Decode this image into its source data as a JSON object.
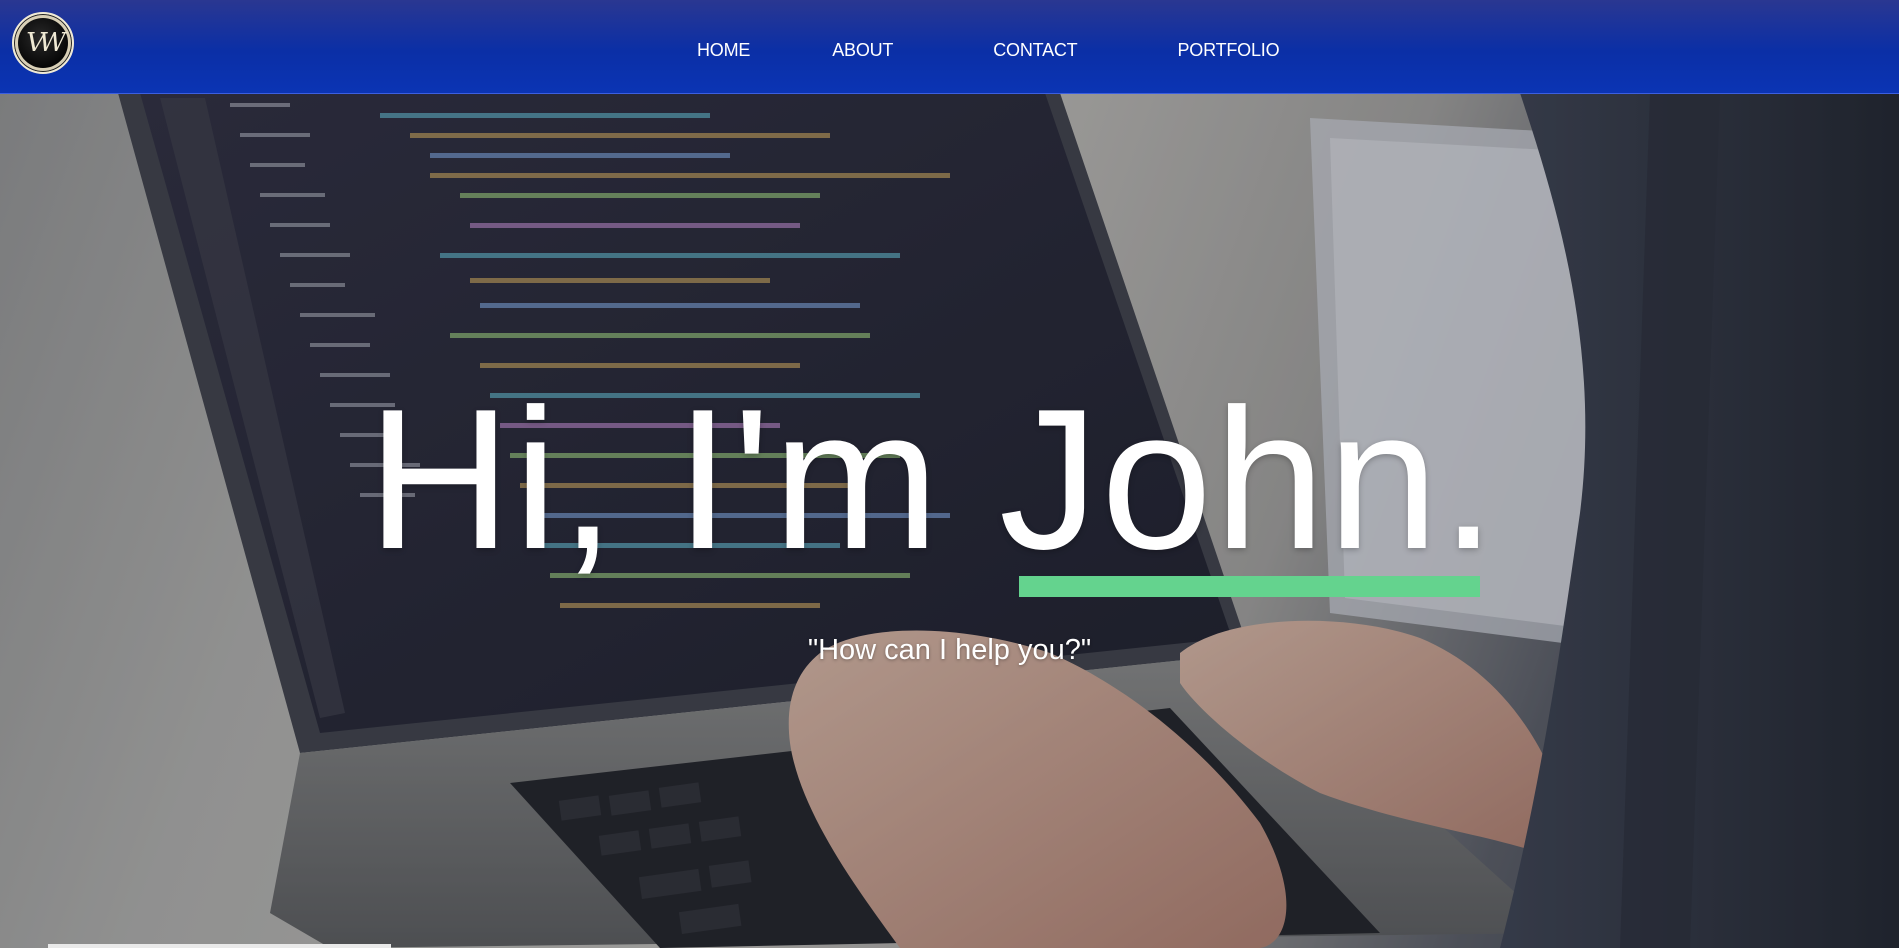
{
  "nav": {
    "logo_alt": "VW",
    "links": [
      {
        "label": "HOME"
      },
      {
        "label": "ABOUT"
      },
      {
        "label": "CONTACT"
      },
      {
        "label": "PORTFOLIO"
      }
    ]
  },
  "hero": {
    "greeting": "Hi, I'm ",
    "name": "John",
    "punctuation": ".",
    "tagline": "\"How can I help you?\""
  },
  "colors": {
    "nav_background": "#0b2fa6",
    "accent_underline": "#64d38e",
    "text": "#ffffff"
  }
}
